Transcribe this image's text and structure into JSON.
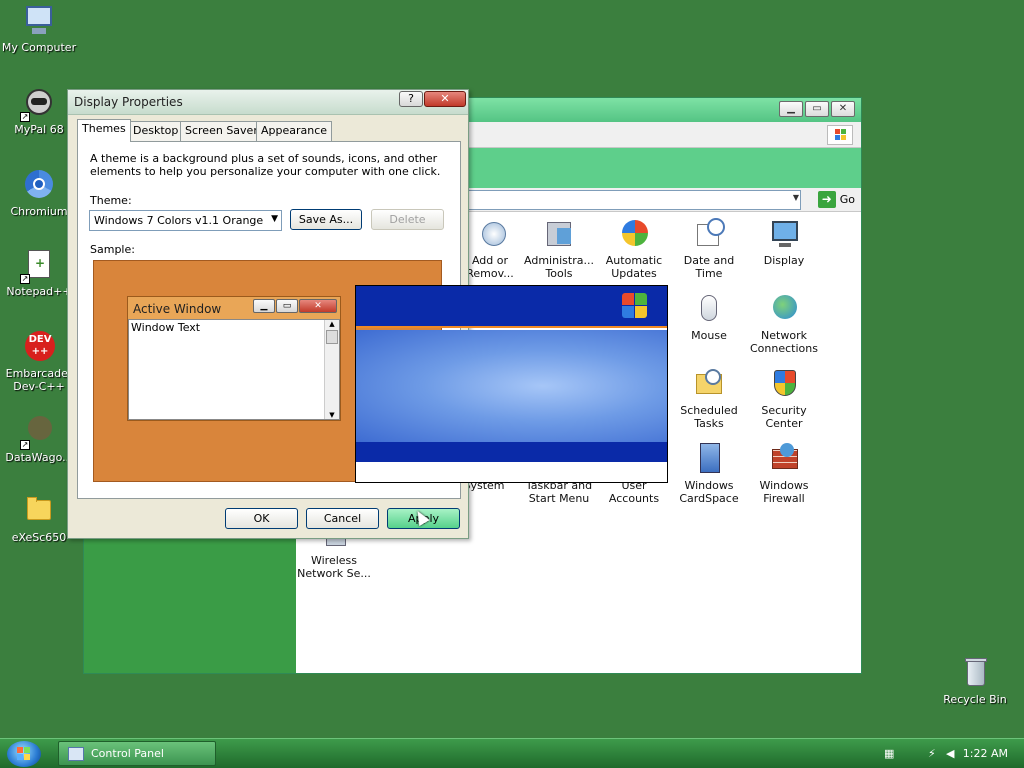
{
  "desktop": {
    "icons": [
      {
        "label": "My Computer",
        "icon": "computer-icon"
      },
      {
        "label": "MyPal 68",
        "icon": "raccoon-browser-icon"
      },
      {
        "label": "Chromium",
        "icon": "chromium-icon"
      },
      {
        "label": "Notepad++",
        "icon": "notepad-plus-icon"
      },
      {
        "label": "Embarcadero Dev-C++",
        "line1": "Embarcader",
        "line2": "Dev-C++",
        "icon": "devcpp-icon"
      },
      {
        "label": "DataWago...",
        "icon": "datawagon-icon"
      },
      {
        "label": "eXeSc650",
        "icon": "folder-icon"
      },
      {
        "label": "Recycle Bin",
        "icon": "recycle-bin-icon"
      }
    ]
  },
  "control_panel": {
    "go_label": "Go",
    "items": [
      {
        "line1": "Add or",
        "line2": "Remov...",
        "icon": "add-remove-programs-icon"
      },
      {
        "line1": "Administra...",
        "line2": "Tools",
        "icon": "admin-tools-icon"
      },
      {
        "line1": "Automatic",
        "line2": "Updates",
        "icon": "automatic-updates-icon"
      },
      {
        "line1": "Date and",
        "line2": "Time",
        "icon": "date-time-icon"
      },
      {
        "line1": "Display",
        "line2": "",
        "icon": "display-icon"
      },
      {
        "line1": "Mouse",
        "line2": "",
        "icon": "mouse-icon"
      },
      {
        "line1": "Network",
        "line2": "Connections",
        "icon": "network-connections-icon"
      },
      {
        "line1": "Scheduled",
        "line2": "Tasks",
        "icon": "scheduled-tasks-icon"
      },
      {
        "line1": "Security",
        "line2": "Center",
        "icon": "security-center-icon"
      },
      {
        "line1": "System",
        "line2": "",
        "icon": "system-icon"
      },
      {
        "line1": "Taskbar and",
        "line2": "Start Menu",
        "icon": "taskbar-start-menu-icon"
      },
      {
        "line1": "User",
        "line2": "Accounts",
        "icon": "user-accounts-icon"
      },
      {
        "line1": "Windows",
        "line2": "CardSpace",
        "icon": "cardspace-icon"
      },
      {
        "line1": "Windows",
        "line2": "Firewall",
        "icon": "firewall-icon"
      },
      {
        "line1": "Wireless",
        "line2": "Network Se...",
        "icon": "wireless-network-icon"
      }
    ]
  },
  "dialog": {
    "title": "Display Properties",
    "help": "?",
    "tabs": [
      "Themes",
      "Desktop",
      "Screen Saver",
      "Appearance"
    ],
    "description": "A theme is a background plus a set of sounds, icons, and other elements to help you personalize your computer with one click.",
    "theme_label": "Theme:",
    "theme_value": "Windows 7 Colors v1.1 Orange",
    "save_as": "Save As...",
    "delete": "Delete",
    "sample_label": "Sample:",
    "sample_window": {
      "title": "Active Window",
      "text": "Window Text"
    },
    "ok": "OK",
    "cancel": "Cancel",
    "apply": "Apply"
  },
  "taskbar": {
    "task_label": "Control Panel",
    "clock": "1:22 AM"
  }
}
